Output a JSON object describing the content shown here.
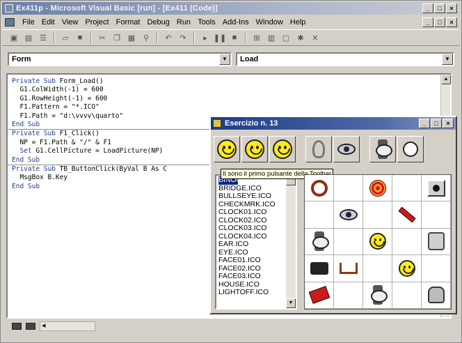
{
  "app": {
    "title": "Ex411p - Microsoft Visual Basic [run] - [Ex411 (Code)]"
  },
  "menu": [
    {
      "label": "File"
    },
    {
      "label": "Edit"
    },
    {
      "label": "View"
    },
    {
      "label": "Project"
    },
    {
      "label": "Format"
    },
    {
      "label": "Debug"
    },
    {
      "label": "Run"
    },
    {
      "label": "Tools"
    },
    {
      "label": "Add-Ins"
    },
    {
      "label": "Window"
    },
    {
      "label": "Help"
    }
  ],
  "toolbar": {
    "icons": [
      "add-project-icon",
      "add-form-icon",
      "menu-editor-icon",
      "open-icon",
      "save-icon",
      "cut-icon",
      "copy-icon",
      "paste-icon",
      "find-icon",
      "undo-icon",
      "redo-icon",
      "start-icon",
      "break-icon",
      "end-icon",
      "project-explorer-icon",
      "properties-icon",
      "form-layout-icon",
      "object-browser-icon",
      "toolbox-icon"
    ]
  },
  "code_window": {
    "object_combo": "Form",
    "procedure_combo": "Load",
    "procedures": [
      [
        {
          "kw": "Private Sub",
          "text": " Form_Load()"
        },
        {
          "kw": "",
          "text": "  G1.ColWidth(-1) = 600"
        },
        {
          "kw": "",
          "text": "  G1.RowHeight(-1) = 600"
        },
        {
          "kw": "",
          "text": "  F1.Pattern = \"*.ICO\""
        },
        {
          "kw": "",
          "text": "  F1.Path = \"d:\\vvvv\\quarto\""
        },
        {
          "kw": "End Sub",
          "text": ""
        }
      ],
      [
        {
          "kw": "Private Sub",
          "text": " F1_Click()"
        },
        {
          "kw": "",
          "text": "  NP = F1.Path & \"/\" & F1"
        },
        {
          "kw": "  Set",
          "text": " G1.CellPicture = LoadPicture(NP)"
        },
        {
          "kw": "End Sub",
          "text": ""
        }
      ],
      [
        {
          "kw": "Private Sub",
          "text": " TB_ButtonClick(ByVal B As C"
        },
        {
          "kw": "",
          "text": "  MsgBox B.Key"
        },
        {
          "kw": "End Sub",
          "text": ""
        }
      ]
    ]
  },
  "dialog": {
    "title": "Esercizio n. 13",
    "tooltip": "Il sono il primo pulsante della Toolbar",
    "file_list": [
      "BINOCULR.ICO",
      "BRIDGE.ICO",
      "BULLSEYE.ICO",
      "CHECKMRK.ICO",
      "CLOCK01.ICO",
      "CLOCK02.ICO",
      "CLOCK03.ICO",
      "CLOCK04.ICO",
      "EAR.ICO",
      "EYE.ICO",
      "FACE01.ICO",
      "FACE02.ICO",
      "FACE03.ICO",
      "HOUSE.ICO",
      "LIGHTOFF.ICO"
    ],
    "toolbar_buttons": [
      "face01-icon",
      "face02-icon",
      "face03-icon",
      "ear-icon",
      "eye-icon",
      "clock01-icon",
      "clock02-icon"
    ],
    "grid": [
      [
        "ring-icon",
        "",
        "bullseye-icon",
        "",
        "button-icon"
      ],
      [
        "",
        "eye-icon",
        "",
        "dynamite-icon",
        ""
      ],
      [
        "watch-icon",
        "",
        "smiley-icon",
        "",
        "lock-icon"
      ],
      [
        "binoculars-icon",
        "bridge-icon",
        "",
        "smiley-icon",
        ""
      ],
      [
        "burst-icon",
        "",
        "clock-icon",
        "",
        "face-icon"
      ]
    ]
  }
}
